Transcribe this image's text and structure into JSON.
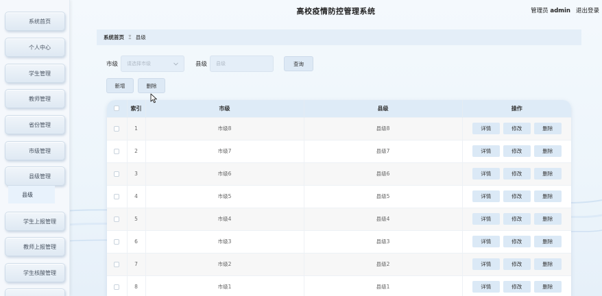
{
  "header": {
    "title": "高校疫情防控管理系统",
    "user_role": "管理员",
    "user_name": "admin",
    "logout": "退出登录"
  },
  "sidebar": {
    "items": [
      {
        "label": "系统首页"
      },
      {
        "label": "个人中心"
      },
      {
        "label": "学生管理"
      },
      {
        "label": "教师管理"
      },
      {
        "label": "省份管理"
      },
      {
        "label": "市级管理"
      },
      {
        "label": "县级管理"
      },
      {
        "label": "学生上报管理"
      },
      {
        "label": "教师上报管理"
      },
      {
        "label": "学生核酸管理"
      }
    ],
    "active_sub": "县级"
  },
  "breadcrumb": {
    "home": "系统首页",
    "separator": "Ξ",
    "current": "县级"
  },
  "search": {
    "city_label": "市级",
    "city_placeholder": "请选择市级",
    "county_label": "县级",
    "county_placeholder": "县级",
    "query_button": "查询"
  },
  "actions": {
    "add": "新增",
    "delete": "删除"
  },
  "table": {
    "headers": {
      "index": "索引",
      "city": "市级",
      "county": "县级",
      "ops": "操作"
    },
    "op_labels": {
      "detail": "详情",
      "edit": "修改",
      "delete": "删除"
    },
    "rows": [
      {
        "index": "1",
        "city": "市级8",
        "county": "县级8"
      },
      {
        "index": "2",
        "city": "市级7",
        "county": "县级7"
      },
      {
        "index": "3",
        "city": "市级6",
        "county": "县级6"
      },
      {
        "index": "4",
        "city": "市级5",
        "county": "县级5"
      },
      {
        "index": "5",
        "city": "市级4",
        "county": "县级4"
      },
      {
        "index": "6",
        "city": "市级3",
        "county": "县级3"
      },
      {
        "index": "7",
        "city": "市级2",
        "county": "县级2"
      },
      {
        "index": "8",
        "city": "市级1",
        "county": "县级1"
      }
    ]
  },
  "colors": {
    "accent": "#deebf7",
    "sidebar_bg": "#f5f8fc"
  }
}
